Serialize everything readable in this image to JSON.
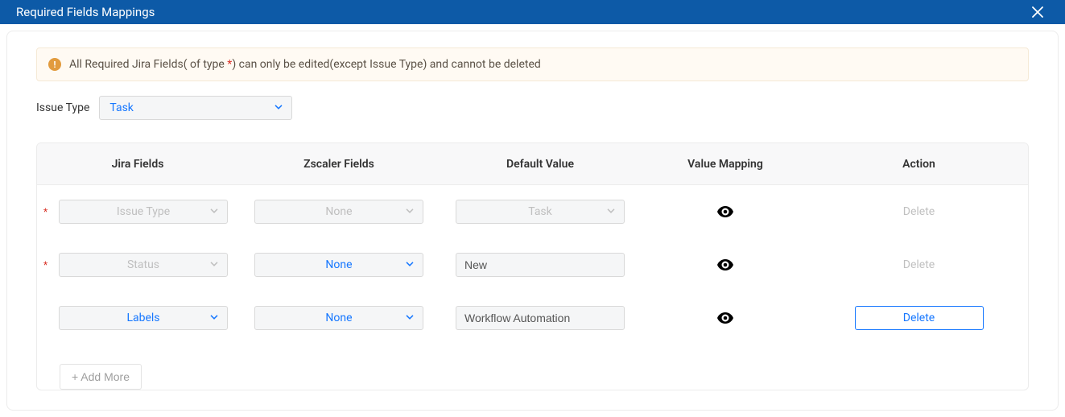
{
  "header": {
    "title": "Required Fields Mappings"
  },
  "alert": {
    "prefix": "All Required Jira Fields( of type ",
    "star": "*",
    "suffix": ") can only be edited(except Issue Type) and cannot be deleted"
  },
  "issueType": {
    "label": "Issue Type",
    "value": "Task"
  },
  "columns": {
    "jira": "Jira Fields",
    "zscaler": "Zscaler Fields",
    "default": "Default Value",
    "mapping": "Value Mapping",
    "action": "Action"
  },
  "rows": [
    {
      "required": true,
      "jira": "Issue Type",
      "jiraDisabled": true,
      "zscaler": "None",
      "zscalerDisabled": true,
      "defaultValue": "Task",
      "defaultAsSelect": true,
      "defaultDisabled": true,
      "deleteEnabled": false,
      "deleteText": "Delete"
    },
    {
      "required": true,
      "jira": "Status",
      "jiraDisabled": true,
      "zscaler": "None",
      "zscalerDisabled": false,
      "defaultValue": "New",
      "defaultAsSelect": false,
      "defaultDisabled": false,
      "deleteEnabled": false,
      "deleteText": "Delete"
    },
    {
      "required": false,
      "jira": "Labels",
      "jiraDisabled": false,
      "zscaler": "None",
      "zscalerDisabled": false,
      "defaultValue": "Workflow Automation",
      "defaultAsSelect": false,
      "defaultDisabled": false,
      "deleteEnabled": true,
      "deleteText": "Delete"
    }
  ],
  "addMore": {
    "label": "+ Add More"
  }
}
